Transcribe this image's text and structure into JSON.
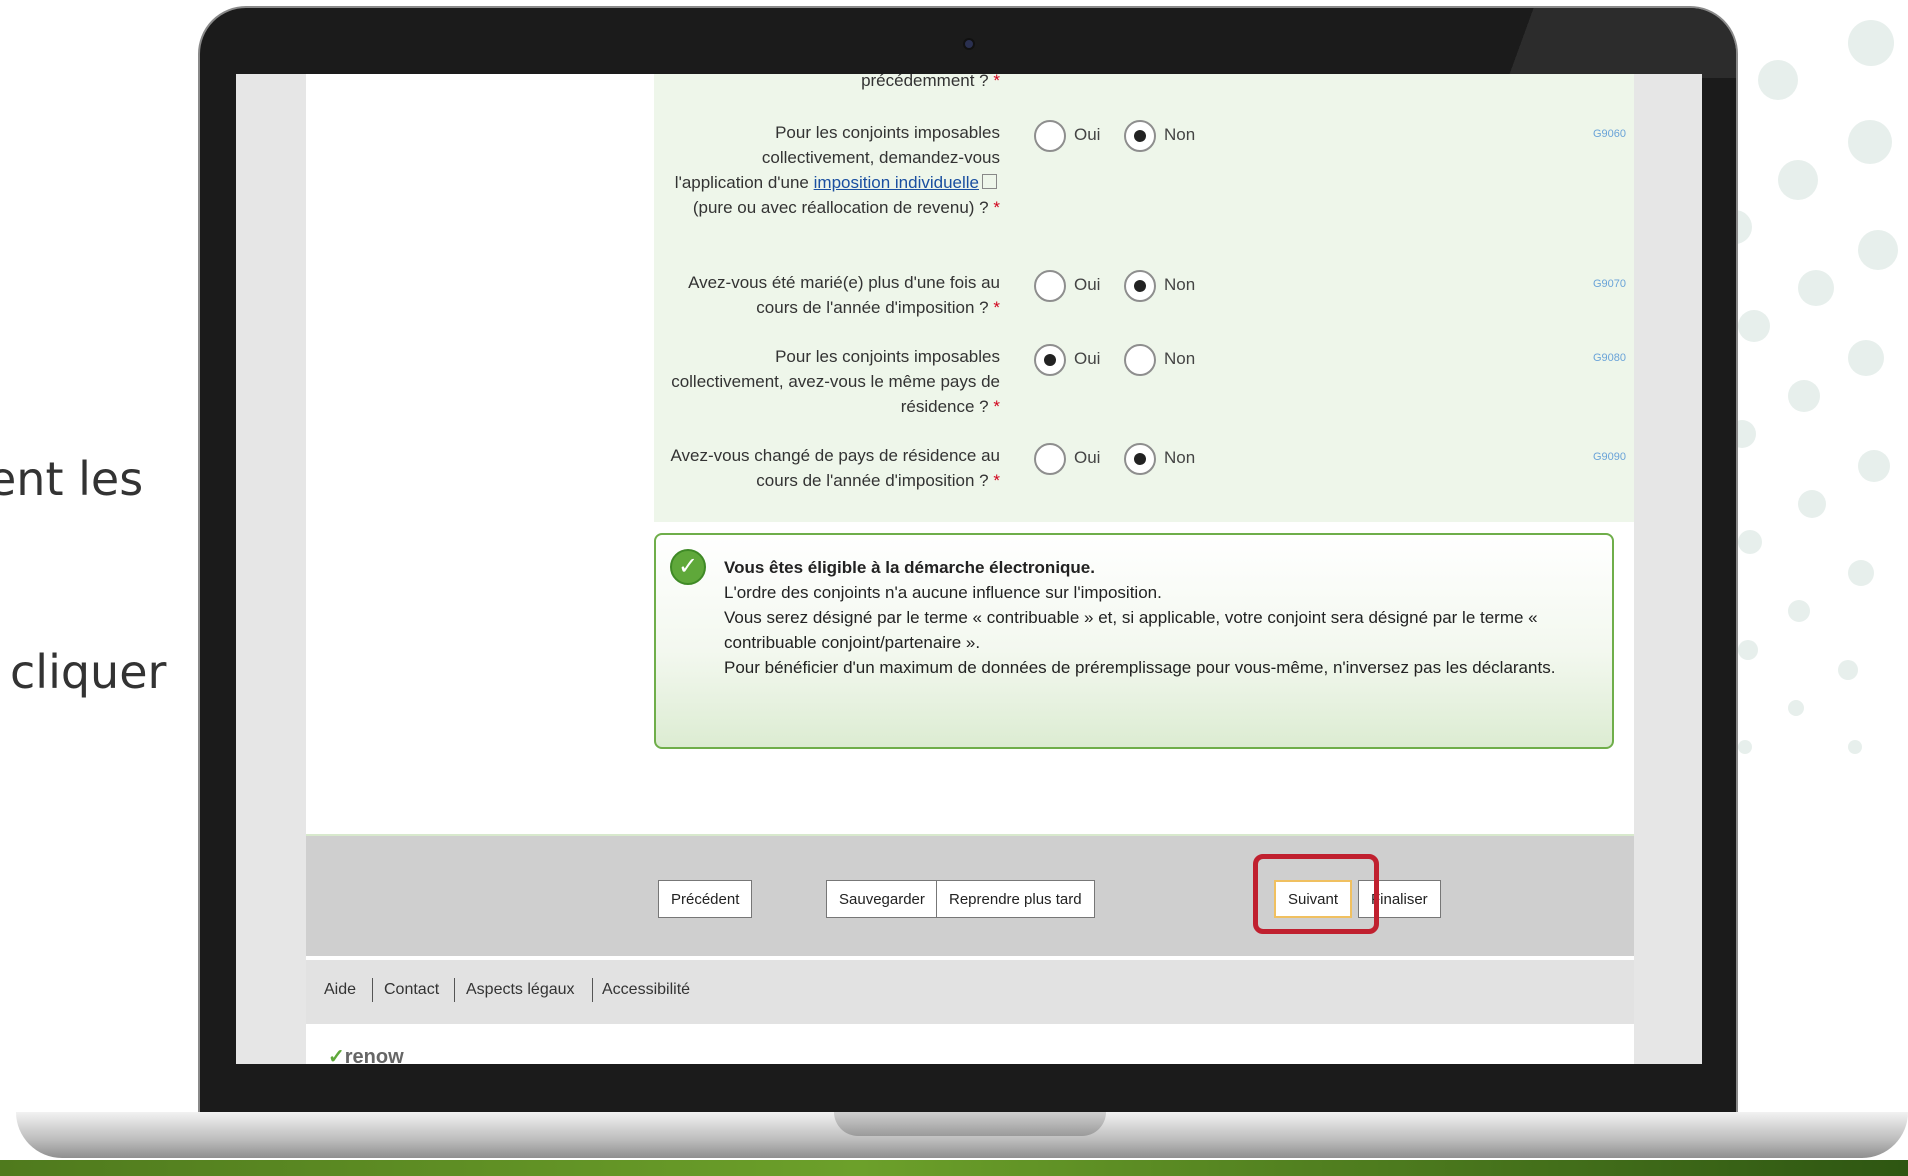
{
  "slide": {
    "text_1": "ent les",
    "text_2": "cliquer"
  },
  "form": {
    "partial_question": "précédemment ?",
    "questions": [
      {
        "label_before_link": "Pour les conjoints imposables collectivement, demandez-vous l'application d'une ",
        "link_text": "imposition individuelle",
        "label_after_link": " (pure ou avec réallocation de revenu) ?",
        "yes_label": "Oui",
        "no_label": "Non",
        "selected": "Non",
        "code": "G9060"
      },
      {
        "label": "Avez-vous été marié(e) plus d'une fois au cours de l'année d'imposition ?",
        "yes_label": "Oui",
        "no_label": "Non",
        "selected": "Non",
        "code": "G9070"
      },
      {
        "label": "Pour les conjoints imposables collectivement, avez-vous le même pays de résidence ?",
        "yes_label": "Oui",
        "no_label": "Non",
        "selected": "Oui",
        "code": "G9080"
      },
      {
        "label": "Avez-vous changé de pays de résidence au cours de l'année d'imposition ?",
        "yes_label": "Oui",
        "no_label": "Non",
        "selected": "Non",
        "code": "G9090"
      }
    ],
    "required_marker": "*"
  },
  "eligibility": {
    "title": "Vous êtes éligible à la démarche électronique.",
    "line_1": "L'ordre des conjoints n'a aucune influence sur l'imposition.",
    "line_2": "Vous serez désigné par le terme « contribuable » et, si applicable, votre conjoint sera désigné par le terme « contribuable conjoint/partenaire ».",
    "line_3": "Pour bénéficier d'un maximum de données de préremplissage pour vous-même, n'inversez pas les déclarants.",
    "icon": "checkmark-circle-icon"
  },
  "buttons": {
    "previous": "Précédent",
    "save": "Sauvegarder",
    "resume_later": "Reprendre plus tard",
    "next": "Suivant",
    "finish": "Finaliser"
  },
  "footer": {
    "help": "Aide",
    "contact": "Contact",
    "legal": "Aspects légaux",
    "accessibility": "Accessibilité"
  },
  "logo_text": "renow",
  "colors": {
    "form_background": "#eef6ea",
    "success_border": "#6fae4a",
    "highlight_border": "#c0202f",
    "required_star": "#d0021b",
    "link": "#1a4fa0"
  }
}
